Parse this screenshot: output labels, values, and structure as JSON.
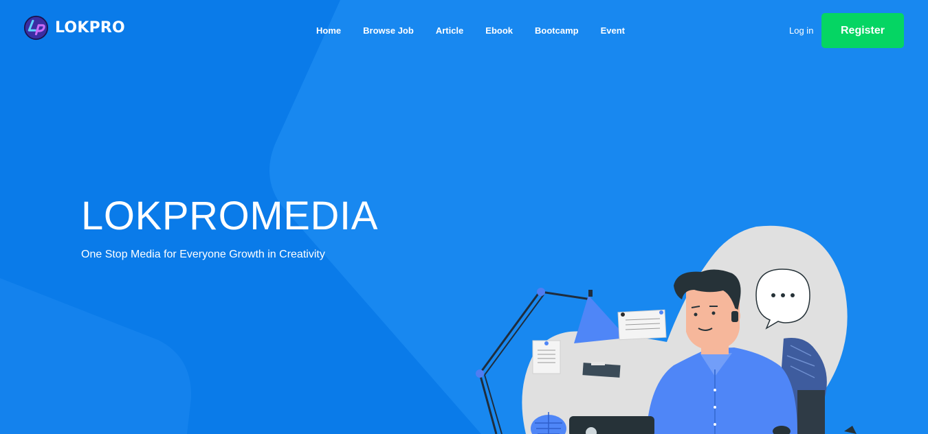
{
  "brand": {
    "name": "LOKPRO",
    "logo_icon": "lokpro-lp-logo-icon"
  },
  "nav": {
    "items": [
      {
        "label": "Home"
      },
      {
        "label": "Browse Job"
      },
      {
        "label": "Article"
      },
      {
        "label": "Ebook"
      },
      {
        "label": "Bootcamp"
      },
      {
        "label": "Event"
      }
    ]
  },
  "auth": {
    "login_label": "Log in",
    "register_label": "Register"
  },
  "hero": {
    "title": "LOKPROMEDIA",
    "subtitle": "One Stop Media for Everyone Growth in Creativity"
  },
  "colors": {
    "background": "#0a7be9",
    "background_light": "#1d8af0",
    "register_button": "#05d563",
    "text": "#ffffff"
  },
  "illustration": {
    "icon": "man-working-at-desk-illustration",
    "speech_bubble": "typing-speech-bubble-icon"
  }
}
